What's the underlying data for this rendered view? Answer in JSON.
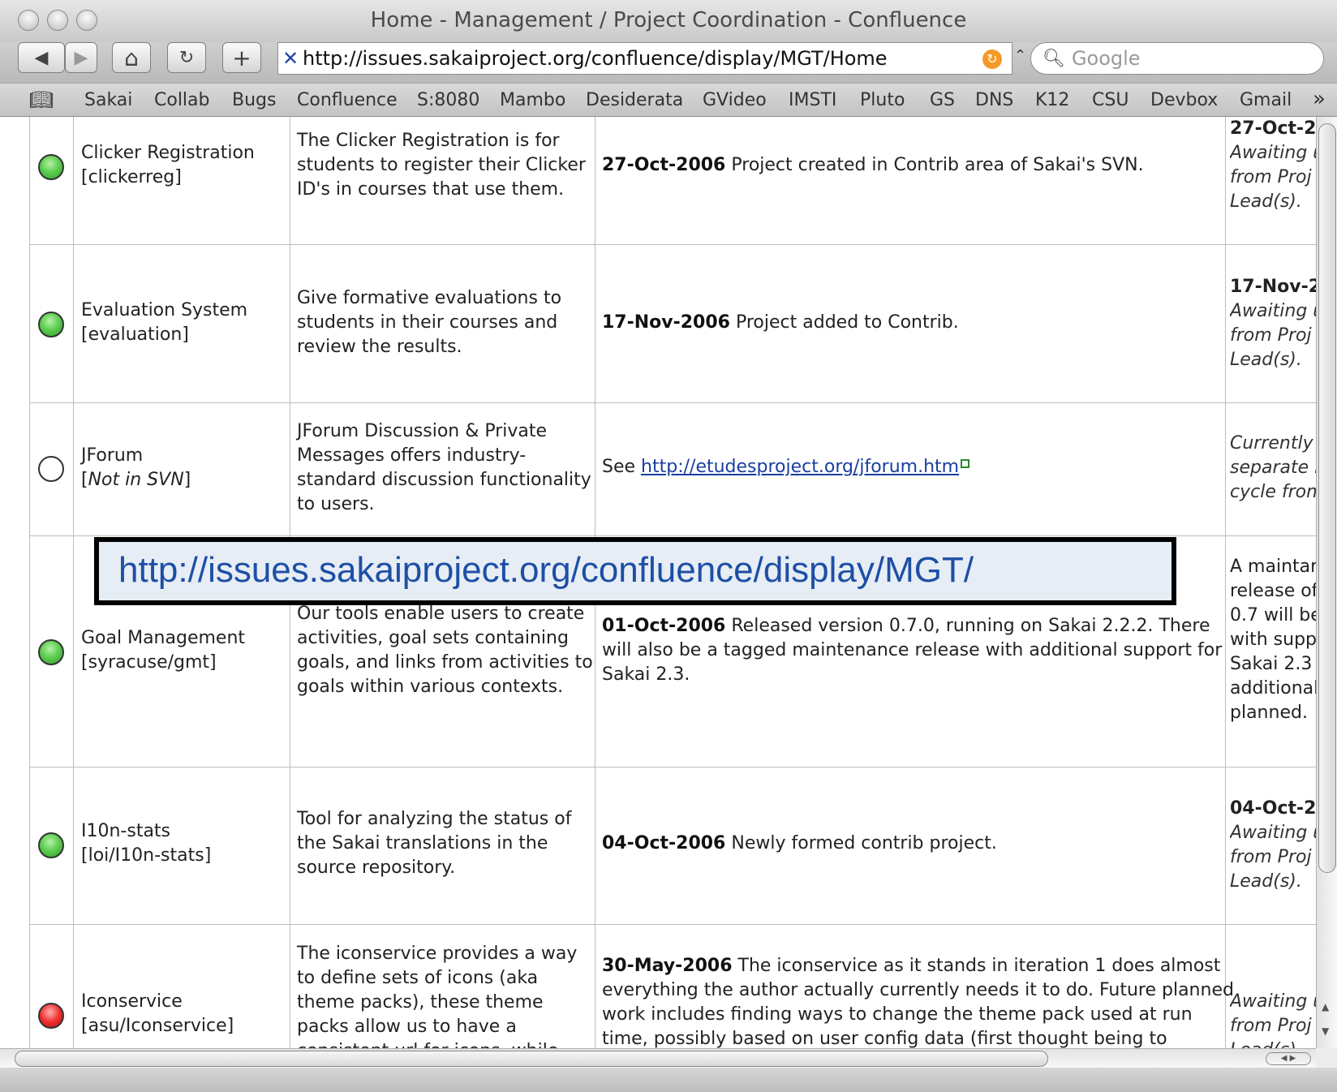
{
  "window": {
    "title": "Home - Management / Project Coordination - Confluence"
  },
  "toolbar": {
    "back_label": "◀",
    "forward_label": "▶",
    "home_label": "⌂",
    "reload_label": "↻",
    "add_label": "+",
    "url": "http://issues.sakaiproject.org/confluence/display/MGT/Home",
    "search_placeholder": "Google"
  },
  "bookmarks": [
    "Sakai",
    "Collab",
    "Bugs",
    "Confluence",
    "S:8080",
    "Mambo",
    "Desiderata",
    "GVideo",
    "IMSTI",
    "Pluto",
    "GS",
    "DNS",
    "K12",
    "CSU",
    "Devbox",
    "Gmail"
  ],
  "rows": [
    {
      "status_color": "green",
      "name": "Clicker Registration",
      "repo": "[clickerreg]",
      "desc": [
        "The Clicker Registration is for",
        "students to register their Clicker",
        "ID's in courses that use them."
      ],
      "news_date": "27-Oct-2006",
      "news": [
        "Project created in Contrib area of Sakai's SVN."
      ],
      "status": [
        "27-Oct-2",
        "Awaiting u",
        "from Proj",
        "Lead(s)."
      ]
    },
    {
      "status_color": "green",
      "name": "Evaluation System",
      "repo": "[evaluation]",
      "desc": [
        "Give formative evaluations to",
        "students in their courses and",
        "review the results."
      ],
      "news_date": "17-Nov-2006",
      "news": [
        "Project added to Contrib."
      ],
      "status": [
        "17-Nov-2",
        "Awaiting u",
        "from Proj",
        "Lead(s)."
      ]
    },
    {
      "status_color": "white",
      "name": "JForum",
      "repo_prefix": "[",
      "repo_italic": "Not in SVN",
      "repo_suffix": "]",
      "desc": [
        "JForum Discussion & Private",
        "Messages offers industry-",
        "standard discussion functionality",
        "to users."
      ],
      "news_see": "See",
      "news_link": "http://etudesproject.org/jforum.htm",
      "status": [
        "Currently",
        "separate r",
        "cycle from"
      ]
    },
    {
      "status_color": "green",
      "name": "Goal Management",
      "repo": "[syracuse/gmt]",
      "desc": [
        "Our tools enable users to create",
        "activities, goal sets containing",
        "goals, and links from activities to",
        "goals within various contexts."
      ],
      "news_date": "01-Oct-2006",
      "news": [
        "Released version 0.7.0, running on Sakai 2.2.2. There",
        "will also be a tagged maintenance release with additional support for",
        "Sakai 2.3."
      ],
      "status": [
        "A maintan",
        "release of",
        "0.7 will be",
        "with supp",
        "Sakai 2.3",
        "additional",
        "planned."
      ]
    },
    {
      "status_color": "green",
      "name": "I10n-stats",
      "repo": "[loi/I10n-stats]",
      "desc": [
        "Tool for analyzing the status of",
        "the Sakai translations in the",
        "source repository."
      ],
      "news_date": "04-Oct-2006",
      "news": [
        "Newly formed contrib project."
      ],
      "status": [
        "04-Oct-2",
        "Awaiting u",
        "from Proj",
        "Lead(s)."
      ]
    },
    {
      "status_color": "red",
      "name": "Iconservice",
      "repo": "[asu/Iconservice]",
      "desc": [
        "The iconservice provides a way",
        "to define sets of icons (aka",
        "theme packs), these theme",
        "packs allow us to have a",
        "consistent url for icons, while"
      ],
      "news_date": "30-May-2006",
      "news": [
        "The iconservice as it stands in iteration 1 does almost",
        "everything the author actually currently needs it to do. Future planned",
        "work includes finding ways to change the theme pack used at run",
        "time, possibly based on user config data (first thought being to"
      ],
      "status": [
        "Awaiting u",
        "from Proj",
        "Lead(s)."
      ]
    }
  ],
  "overlay": {
    "url": "http://issues.sakaiproject.org/confluence/display/MGT/"
  }
}
